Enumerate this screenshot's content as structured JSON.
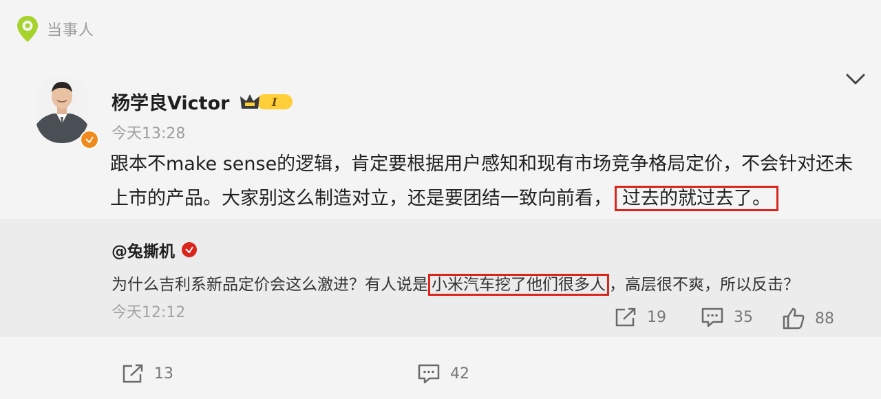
{
  "brand": {
    "name": "当事人",
    "logo_icon": "location-pin-icon",
    "accent": "#a7d32d"
  },
  "post": {
    "author": "杨学良Victor",
    "badge_text": "I",
    "time": "今天13:28",
    "text_main": "跟本不make sense的逻辑，肯定要根据用户感知和现有市场竞争格局定价，不会针对还未上市的产品。大家别这么制造对立，还是要团结一致向前看，",
    "text_highlight": "过去的就过去了。"
  },
  "quote": {
    "author": "@兔撕机",
    "text_before": "为什么吉利系新品定价会这么激进？有人说是",
    "text_highlight": "小米汽车挖了他们很多人",
    "text_after": "，高层很不爽，所以反击？",
    "time": "今天12:12",
    "shares": "19",
    "comments": "35",
    "likes": "88"
  },
  "bottom_bar": {
    "shares": "13",
    "comments": "42"
  },
  "colors": {
    "highlight_border": "#d9261c",
    "verified": "#f08a1c",
    "quote_bg": "#ececec"
  }
}
